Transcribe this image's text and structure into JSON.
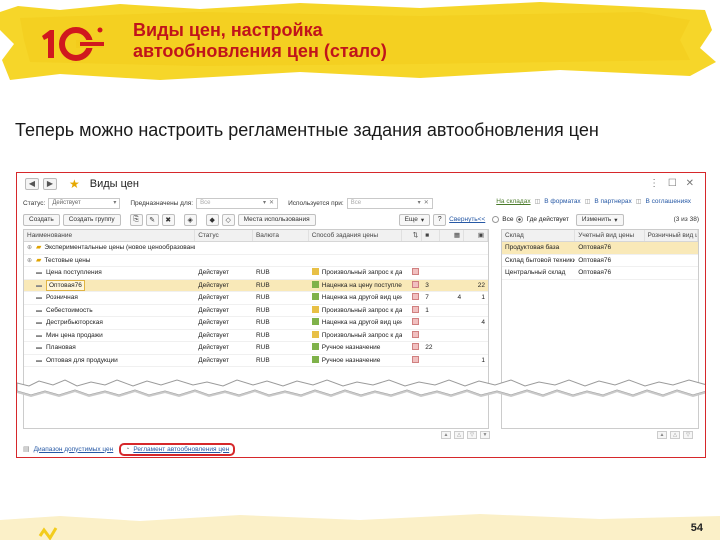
{
  "slide": {
    "title_line1": "Виды цен, настройка",
    "title_line2": "автообновления цен (стало)",
    "subtitle": "Теперь можно настроить регламентные задания автообновления цен",
    "page_number": "54",
    "brand_color": "#c0141b",
    "highlight_color": "#f6d629"
  },
  "window": {
    "title": "Виды цен",
    "back_icon": "arrow-left-icon",
    "forward_icon": "arrow-right-icon",
    "favorite_icon": "star-icon",
    "menu_glyphs": "⋮ ☐ ✕"
  },
  "filters": {
    "status_label": "Статус:",
    "status_value": "Действует",
    "purpose_label": "Предназначены для:",
    "purpose_placeholder": "Все",
    "used_label": "Используется при:",
    "used_placeholder": "Все"
  },
  "top_links": {
    "on_warehouses": "На складах",
    "in_formats": "В форматах",
    "in_partners": "В партнерах",
    "in_agreements": "В соглашениях"
  },
  "toolbar": {
    "create": "Создать",
    "create_group": "Создать группу",
    "usage_places": "Места использования",
    "more": "Еще",
    "collapse": "Свернуть<<",
    "all": "Все",
    "where_active": "Где действует",
    "change": "Изменить",
    "count": "(3 из 38)"
  },
  "grid": {
    "columns": [
      "Наименование",
      "Статус",
      "Валюта",
      "Способ задания цены"
    ],
    "rows": [
      {
        "name": "Экспериментальные цены (новое ценообразование)",
        "status": "",
        "currency": "",
        "method": "",
        "a": "",
        "c": "",
        "d": "",
        "kind": "folder"
      },
      {
        "name": "Тестовые цены",
        "status": "",
        "currency": "",
        "method": "",
        "a": "",
        "c": "",
        "d": "",
        "kind": "folder"
      },
      {
        "name": "Цена поступления",
        "status": "Действует",
        "currency": "RUB",
        "method": "Произвольный запрос к дан...",
        "a": "",
        "c": "",
        "d": "",
        "kind": "item",
        "micon": "y"
      },
      {
        "name": "Оптовая76",
        "status": "Действует",
        "currency": "RUB",
        "method": "Наценка на цену поступления",
        "a": "3",
        "c": "",
        "d": "22",
        "kind": "item",
        "micon": "g"
      },
      {
        "name": "Розничная",
        "status": "Действует",
        "currency": "RUB",
        "method": "Наценка на другой вид цен",
        "a": "7",
        "c": "4",
        "d": "1",
        "kind": "item",
        "micon": "g"
      },
      {
        "name": "Себестоимость",
        "status": "Действует",
        "currency": "RUB",
        "method": "Произвольный запрос к дан...",
        "a": "1",
        "c": "",
        "d": "",
        "kind": "item",
        "micon": "y"
      },
      {
        "name": "Дестрибьюторская",
        "status": "Действует",
        "currency": "RUB",
        "method": "Наценка на другой вид цен",
        "a": "",
        "c": "",
        "d": "4",
        "kind": "item",
        "micon": "g"
      },
      {
        "name": "Мин цена продажи",
        "status": "Действует",
        "currency": "RUB",
        "method": "Произвольный запрос к дан...",
        "a": "",
        "c": "",
        "d": "",
        "kind": "item",
        "micon": "y"
      },
      {
        "name": "Плановая",
        "status": "Действует",
        "currency": "RUB",
        "method": "Ручное назначение",
        "a": "22",
        "c": "",
        "d": "",
        "kind": "item",
        "micon": "g"
      },
      {
        "name": "Оптовая для продукции",
        "status": "Действует",
        "currency": "RUB",
        "method": "Ручное назначение",
        "a": "",
        "c": "",
        "d": "1",
        "kind": "item",
        "micon": "g"
      }
    ]
  },
  "side_grid": {
    "columns": [
      "Склад",
      "Учетный вид цены",
      "Розничный вид цены"
    ],
    "rows": [
      {
        "warehouse": "Продуктовая база",
        "account_price": "Оптовая76",
        "retail_price": ""
      },
      {
        "warehouse": "Склад бытовой техники",
        "account_price": "Оптовая76",
        "retail_price": ""
      },
      {
        "warehouse": "Центральный склад",
        "account_price": "Оптовая76",
        "retail_price": ""
      }
    ]
  },
  "bottom": {
    "range_link": "Диапазон допустимых цен",
    "schedule_link": "Регламент автообновления цен"
  }
}
